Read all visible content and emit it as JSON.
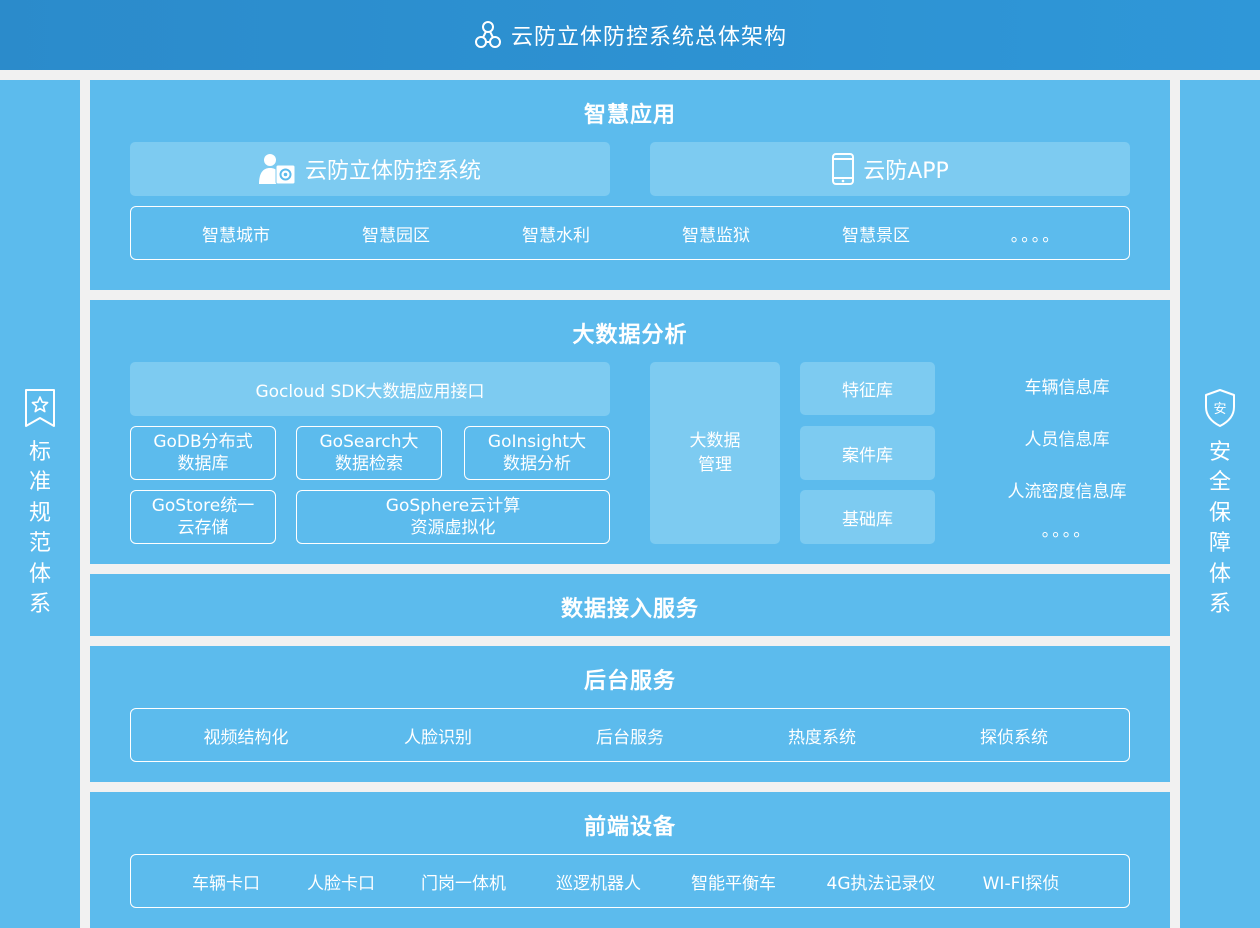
{
  "header": {
    "title": "云防立体防控系统总体架构",
    "icon": "network-nodes-icon"
  },
  "left_pillar": {
    "label": "标准规范体系",
    "icon": "bookmark-star-icon"
  },
  "right_pillar": {
    "label": "安全保障体系",
    "icon": "shield-icon",
    "icon_text": "安"
  },
  "smart_app": {
    "title": "智慧应用",
    "system_box": {
      "label": "云防立体防控系统",
      "icon": "operator-gear-icon"
    },
    "app_box": {
      "label": "云防APP",
      "icon": "smartphone-icon"
    },
    "items": [
      "智慧城市",
      "智慧园区",
      "智慧水利",
      "智慧监狱",
      "智慧景区",
      "。。。。"
    ]
  },
  "big_data": {
    "title": "大数据分析",
    "sdk": "Gocloud SDK大数据应用接口",
    "godb": [
      "GoDB分布式",
      "数据库"
    ],
    "gosearch": [
      "GoSearch大",
      "数据检索"
    ],
    "goinsight": [
      "GoInsight大",
      "数据分析"
    ],
    "gostore": [
      "GoStore统一",
      "云存储"
    ],
    "gosphere": [
      "GoSphere云计算",
      "资源虚拟化"
    ],
    "management": [
      "大数据",
      "管理"
    ],
    "libraries": [
      "特征库",
      "案件库",
      "基础库"
    ],
    "info_dbs": [
      "车辆信息库",
      "人员信息库",
      "人流密度信息库",
      "。。。。"
    ]
  },
  "data_access": {
    "title": "数据接入服务"
  },
  "backend": {
    "title": "后台服务",
    "items": [
      "视频结构化",
      "人脸识别",
      "后台服务",
      "热度系统",
      "探侦系统"
    ]
  },
  "frontend": {
    "title": "前端设备",
    "items": [
      "车辆卡口",
      "人脸卡口",
      "门岗一体机",
      "巡逻机器人",
      "智能平衡车",
      "4G执法记录仪",
      "WI-FI探侦"
    ]
  },
  "colors": {
    "header": "#2f93d4",
    "panel": "#5cbbed",
    "solid_box": "#7dcbf1",
    "background": "#f1f1f1",
    "text": "#ffffff"
  }
}
